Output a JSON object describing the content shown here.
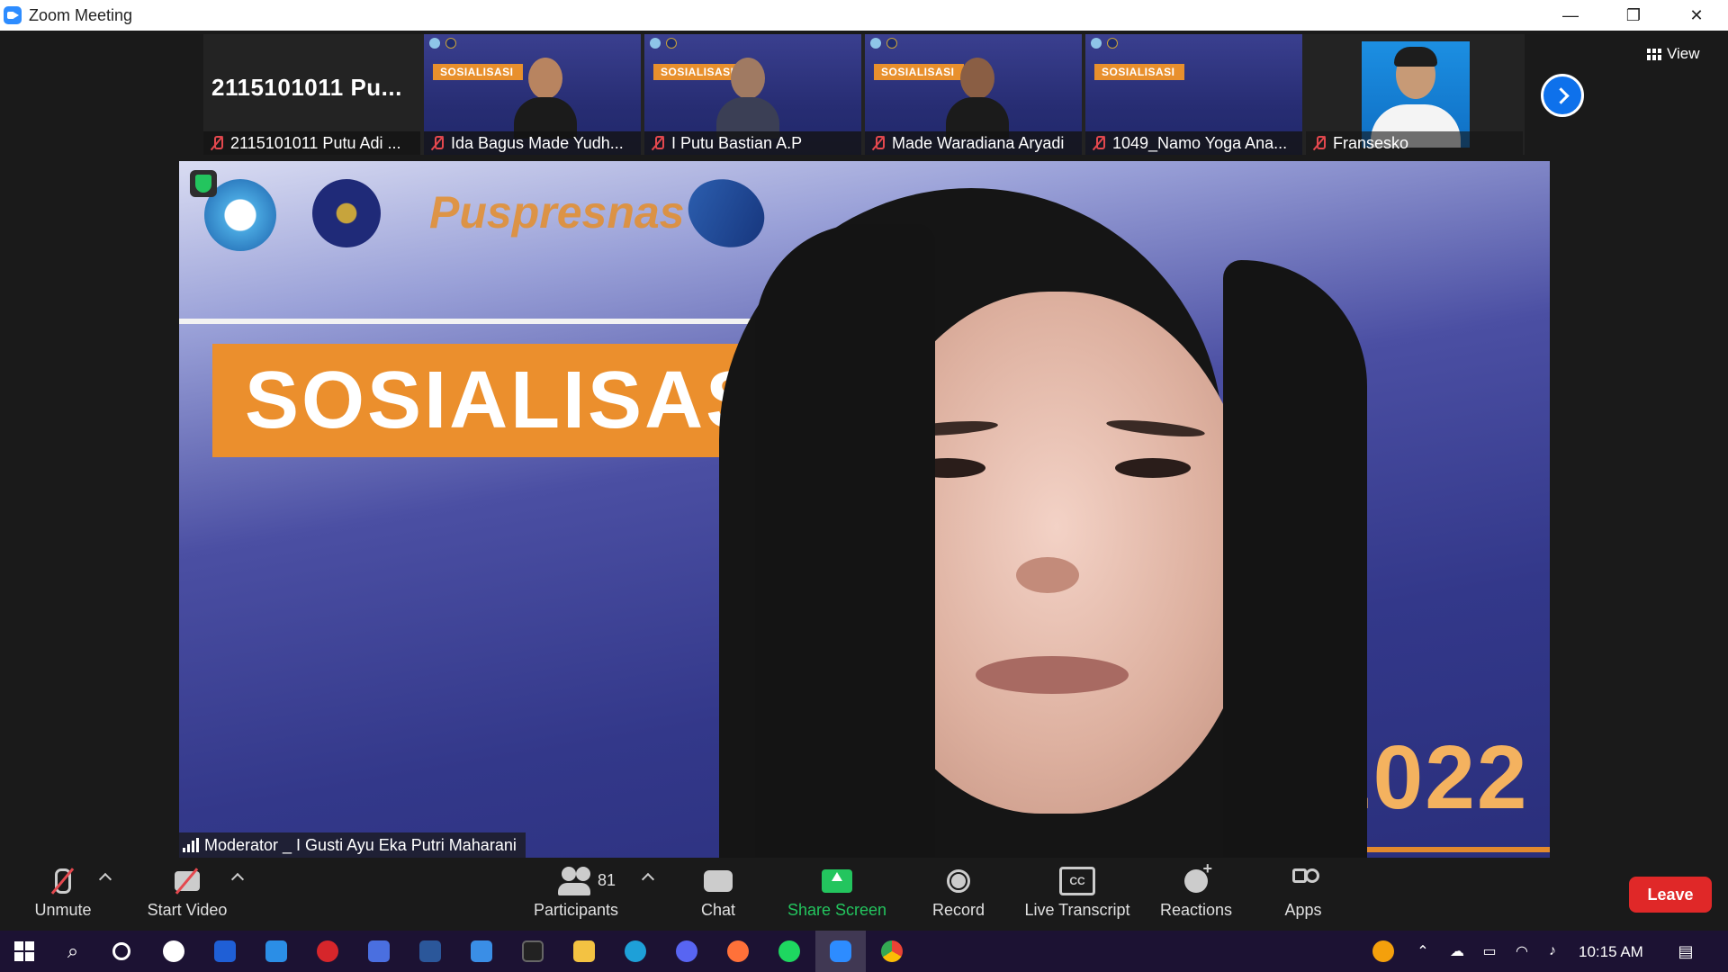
{
  "window": {
    "title": "Zoom Meeting",
    "controls": [
      "—",
      "❐",
      "✕"
    ]
  },
  "thumbnails": [
    {
      "big_name": "2115101011  Pu...",
      "label": "2115101011 Putu Adi ...",
      "muted": true,
      "kind": "no-video"
    },
    {
      "label": "Ida Bagus Made Yudh...",
      "muted": true,
      "kind": "video",
      "banner": "SOSIALISASI"
    },
    {
      "label": "I Putu Bastian A.P",
      "muted": true,
      "kind": "video",
      "banner": "SOSIALISASI"
    },
    {
      "label": "Made Waradiana Aryadi",
      "muted": true,
      "kind": "video",
      "banner": "SOSIALISASI"
    },
    {
      "label": "1049_Namo Yoga Ana...",
      "muted": true,
      "kind": "video",
      "banner": "SOSIALISASI"
    },
    {
      "label": "Fransesko",
      "muted": true,
      "kind": "photo"
    }
  ],
  "view_button": "View",
  "main_video": {
    "banner": "SOSIALISASI",
    "logo_text": "Puspresnas",
    "year_text": "K 2022",
    "speaker_label": "Moderator _ I Gusti Ayu Eka Putri Maharani"
  },
  "toolbar": {
    "unmute": "Unmute",
    "start_video": "Start Video",
    "participants": "Participants",
    "participants_count": "81",
    "chat": "Chat",
    "share_screen": "Share Screen",
    "record": "Record",
    "live_transcript": "Live Transcript",
    "reactions": "Reactions",
    "apps": "Apps",
    "leave": "Leave"
  },
  "colors": {
    "share_green": "#23c55e",
    "leave_red": "#e02828",
    "accent_blue": "#0e71eb",
    "banner_orange": "#eb8f2d",
    "muted_red": "#e4484e"
  },
  "taskbar": {
    "time": "10:15 AM"
  }
}
